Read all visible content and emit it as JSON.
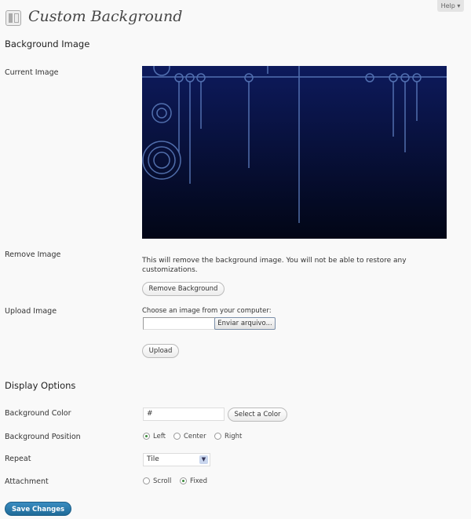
{
  "help_label": "Help ▾",
  "page_title": "Custom Background",
  "background_image": {
    "heading": "Background Image",
    "current_image_label": "Current Image",
    "remove_image_label": "Remove Image",
    "remove_description": "This will remove the background image. You will not be able to restore any customizations.",
    "remove_button": "Remove Background",
    "upload_image_label": "Upload Image",
    "choose_label": "Choose an image from your computer:",
    "file_value": "",
    "browse_button": "Enviar arquivo...",
    "upload_button": "Upload"
  },
  "display_options": {
    "heading": "Display Options",
    "color_label": "Background Color",
    "color_value": "#",
    "select_color_button": "Select a Color",
    "position_label": "Background Position",
    "position_options": [
      "Left",
      "Center",
      "Right"
    ],
    "position_selected": "Left",
    "repeat_label": "Repeat",
    "repeat_value": "Tile",
    "attachment_label": "Attachment",
    "attachment_options": [
      "Scroll",
      "Fixed"
    ],
    "attachment_selected": "Fixed"
  },
  "save_button": "Save Changes",
  "colors": {
    "primary_button": "#21759b",
    "image_top": "#0d1a5c",
    "image_bottom": "#020616"
  }
}
